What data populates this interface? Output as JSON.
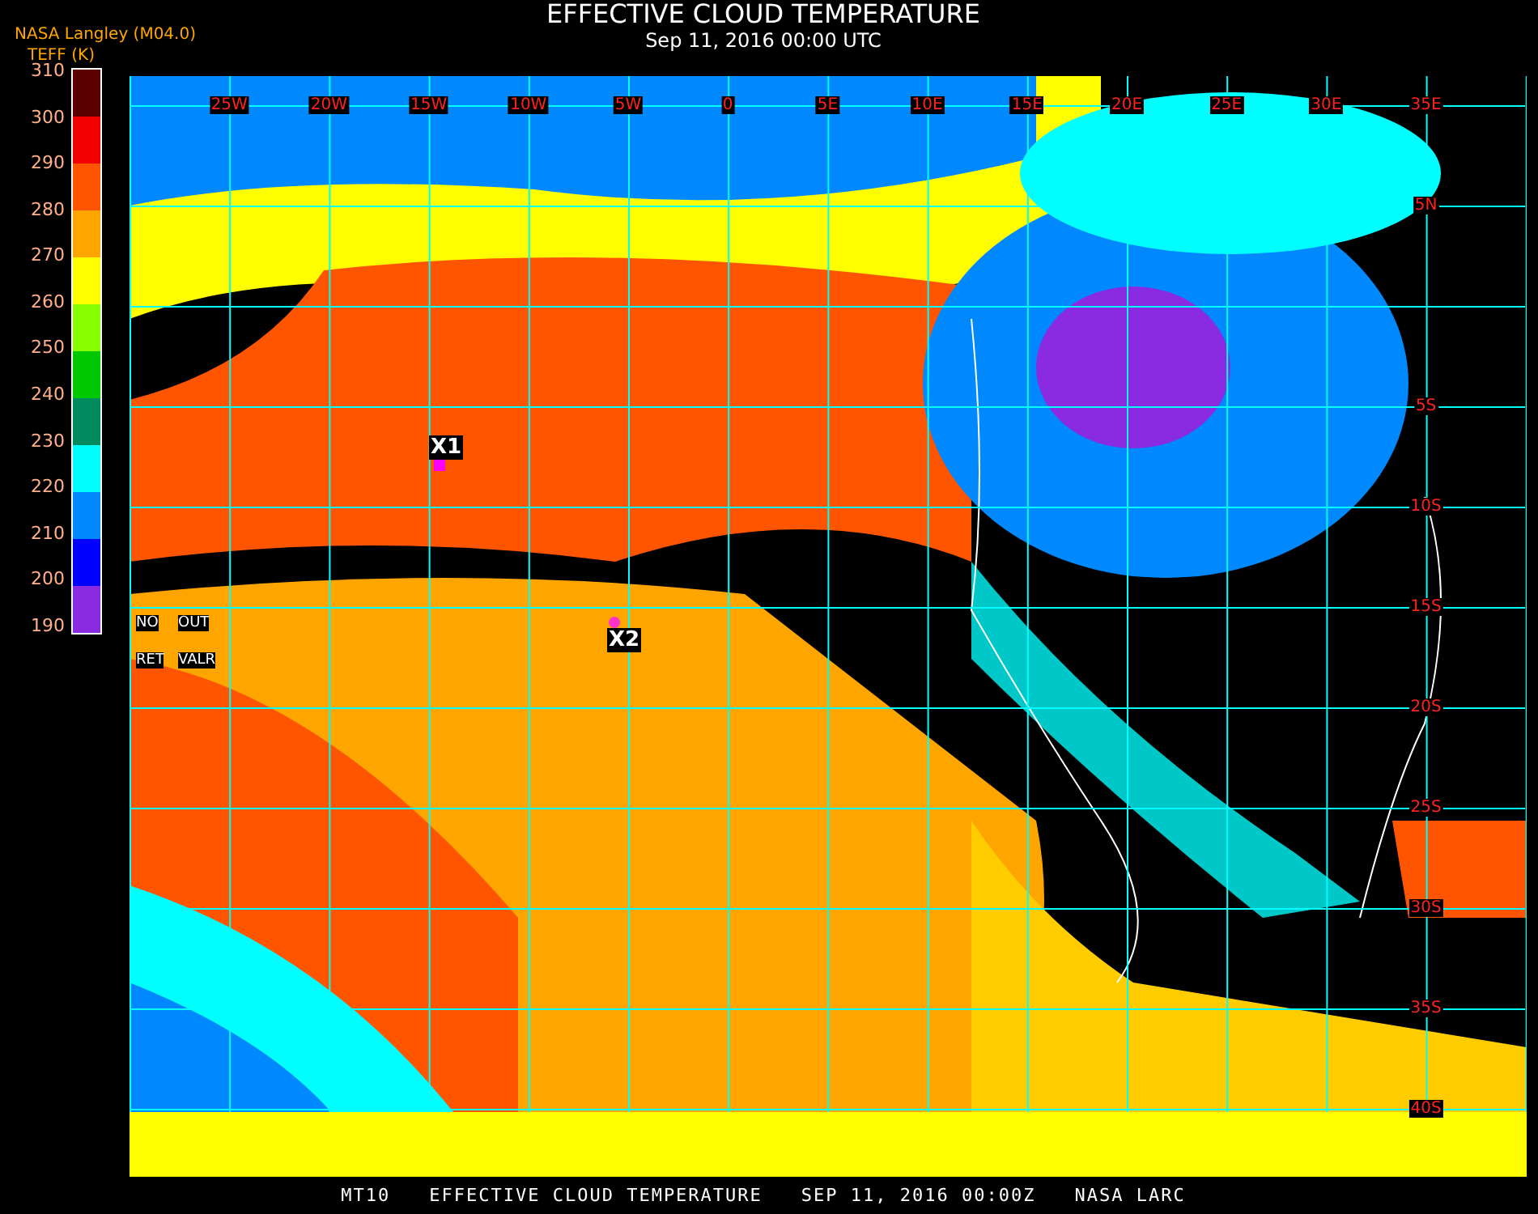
{
  "title": "EFFECTIVE CLOUD TEMPERATURE",
  "subtitle": "Sep 11, 2016 00:00 UTC",
  "legend": {
    "source": "NASA Langley (M04.0)",
    "unit": "TEFF (K)",
    "ticks": [
      "310",
      "300",
      "290",
      "280",
      "270",
      "260",
      "250",
      "240",
      "230",
      "220",
      "210",
      "200",
      "190"
    ],
    "bands": [
      {
        "color": "#5c0000"
      },
      {
        "color": "#f00000"
      },
      {
        "color": "#ff5500"
      },
      {
        "color": "#ffa500"
      },
      {
        "color": "#ffff00"
      },
      {
        "color": "#88ff00"
      },
      {
        "color": "#00c800"
      },
      {
        "color": "#008a5e"
      },
      {
        "color": "#00ffff"
      },
      {
        "color": "#0088ff"
      },
      {
        "color": "#0000ff"
      },
      {
        "color": "#8a2be2"
      }
    ],
    "no_data": [
      "NO",
      "OUT",
      "RET",
      "VALR"
    ]
  },
  "map": {
    "lon_labels": [
      "25W",
      "20W",
      "15W",
      "10W",
      "5W",
      "0",
      "5E",
      "10E",
      "15E",
      "20E",
      "25E",
      "30E",
      "35E"
    ],
    "lat_labels": [
      "5N",
      "5S",
      "10S",
      "15S",
      "20S",
      "25S",
      "30S",
      "35S",
      "40S"
    ],
    "markers": [
      {
        "label": "X1",
        "kind": "square",
        "color": "#ff00ff"
      },
      {
        "label": "X2",
        "kind": "circle",
        "color": "#ff33cc"
      }
    ]
  },
  "footer": [
    "MT10",
    "EFFECTIVE CLOUD TEMPERATURE",
    "SEP 11, 2016 00:00Z",
    "NASA LARC"
  ]
}
